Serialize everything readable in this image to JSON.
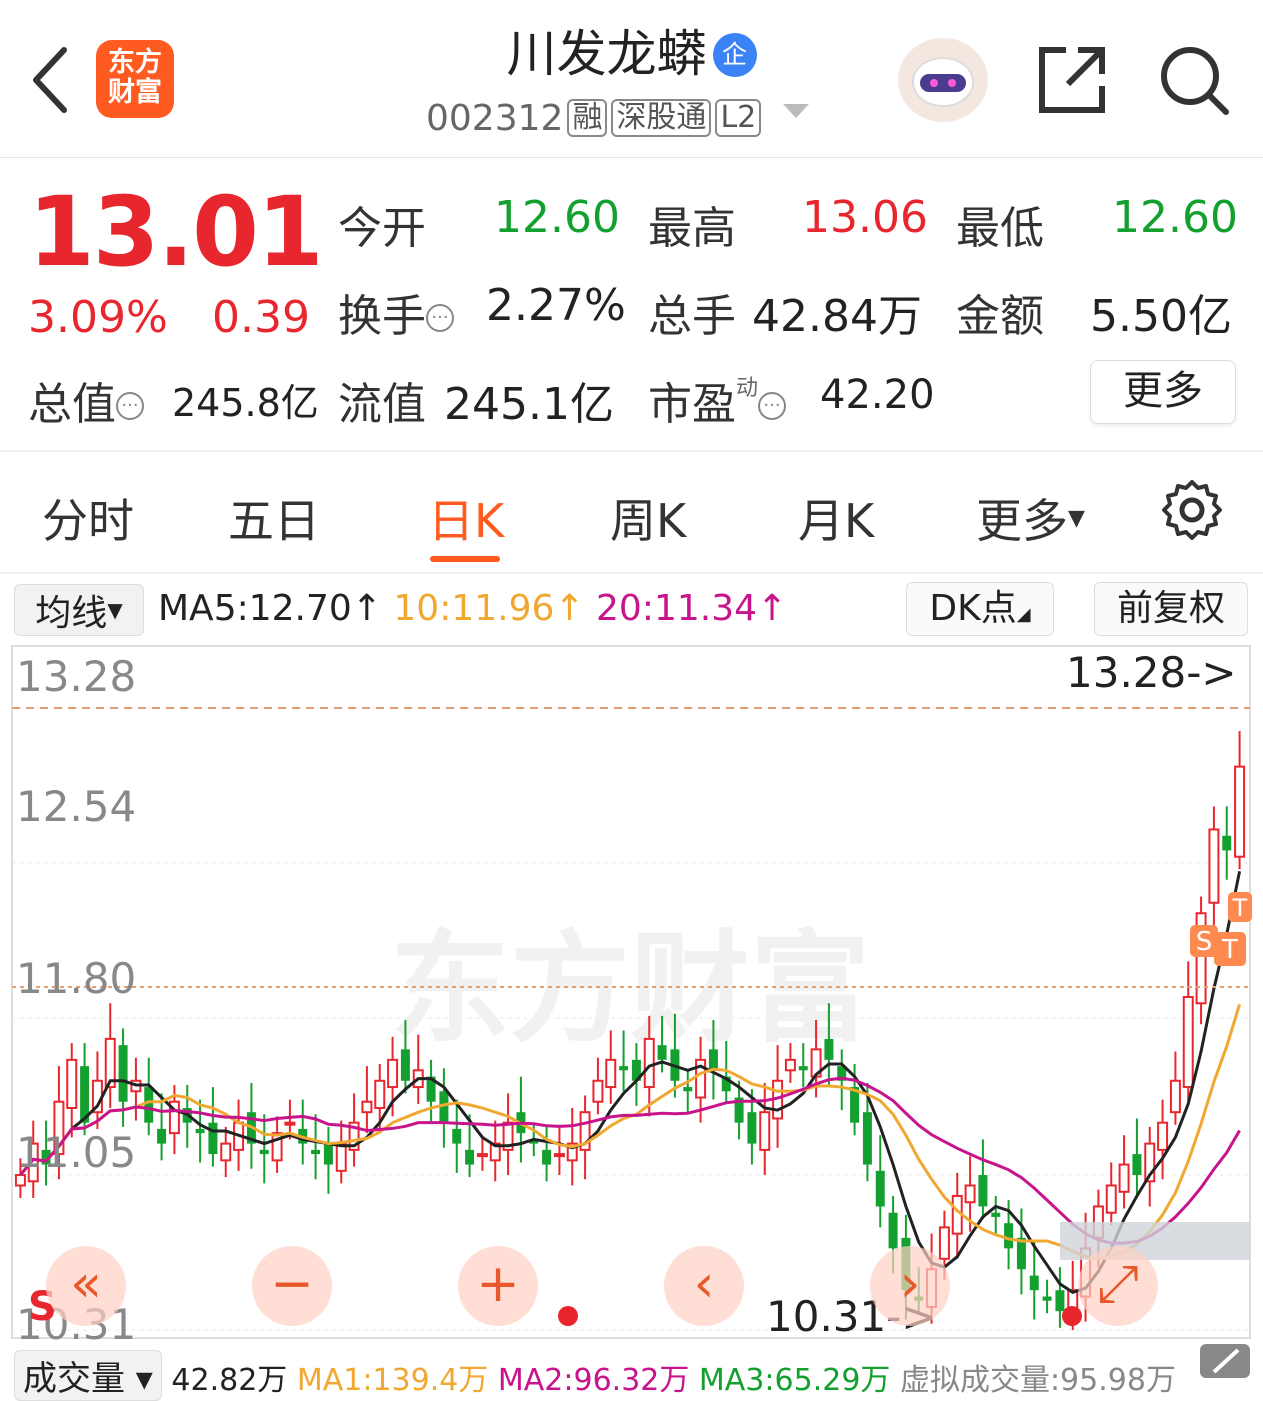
{
  "header": {
    "title": "川发龙蟒",
    "badge": "企",
    "code": "002312",
    "tags": [
      "融",
      "深股通",
      "L2"
    ],
    "logo_line1": "东方",
    "logo_line2": "财富"
  },
  "quote": {
    "price": "13.01",
    "change_pct": "3.09%",
    "change": "0.39",
    "open_label": "今开",
    "open": "12.60",
    "high_label": "最高",
    "high": "13.06",
    "low_label": "最低",
    "low": "12.60",
    "turnover_label": "换手",
    "turnover": "2.27%",
    "volume_label": "总手",
    "volume": "42.84万",
    "amount_label": "金额",
    "amount": "5.50亿",
    "mktcap_label": "总值",
    "mktcap": "245.8亿",
    "float_label": "流值",
    "float_cap": "245.1亿",
    "pe_label": "市盈",
    "pe_sup": "动",
    "pe": "42.20",
    "more": "更多"
  },
  "tabs": [
    "分时",
    "五日",
    "日K",
    "周K",
    "月K",
    "更多"
  ],
  "ma": {
    "select": "均线",
    "ma5": "MA5:12.70",
    "ma10": "10:11.96",
    "ma20": "20:11.34",
    "dk": "DK点",
    "adjust": "前复权"
  },
  "chart_labels": {
    "y_ticks": [
      "13.28",
      "12.54",
      "11.80",
      "11.05",
      "10.31"
    ],
    "max_marker": "13.28->",
    "min_marker": "10.31->",
    "s_mark": "S"
  },
  "volume_row": {
    "label": "成交量",
    "value": "42.82万",
    "ma1": "MA1:139.4万",
    "ma2": "MA2:96.32万",
    "ma3": "MA3:65.29万",
    "virtual": "虚拟成交量:95.98万"
  },
  "colors": {
    "up": "#e8262d",
    "down": "#14a02f",
    "accent": "#ff5a1f",
    "ma5": "#222222",
    "ma10": "#f0a830",
    "ma20": "#c8148c"
  },
  "chart_data": {
    "type": "candlestick",
    "ylim": [
      10.31,
      13.28
    ],
    "closes": [
      11.05,
      11.2,
      11.1,
      11.4,
      11.6,
      11.3,
      11.5,
      11.7,
      11.4,
      11.5,
      11.3,
      11.2,
      11.4,
      11.3,
      11.25,
      11.15,
      11.2,
      11.3,
      11.2,
      11.15,
      11.25,
      11.3,
      11.2,
      11.15,
      11.1,
      11.2,
      11.3,
      11.4,
      11.5,
      11.6,
      11.5,
      11.55,
      11.4,
      11.3,
      11.2,
      11.1,
      11.15,
      11.2,
      11.3,
      11.25,
      11.2,
      11.1,
      11.15,
      11.2,
      11.35,
      11.5,
      11.6,
      11.55,
      11.5,
      11.7,
      11.6,
      11.5,
      11.45,
      11.6,
      11.55,
      11.45,
      11.3,
      11.2,
      11.35,
      11.5,
      11.6,
      11.55,
      11.65,
      11.6,
      11.5,
      11.3,
      11.1,
      10.9,
      10.7,
      10.5,
      10.45,
      10.6,
      10.8,
      10.95,
      11.0,
      10.9,
      10.85,
      10.7,
      10.6,
      10.5,
      10.45,
      10.4,
      10.5,
      10.7,
      10.9,
      11.0,
      11.1,
      11.05,
      11.2,
      11.3,
      11.5,
      11.9,
      12.3,
      12.7,
      12.6,
      13.0
    ]
  }
}
